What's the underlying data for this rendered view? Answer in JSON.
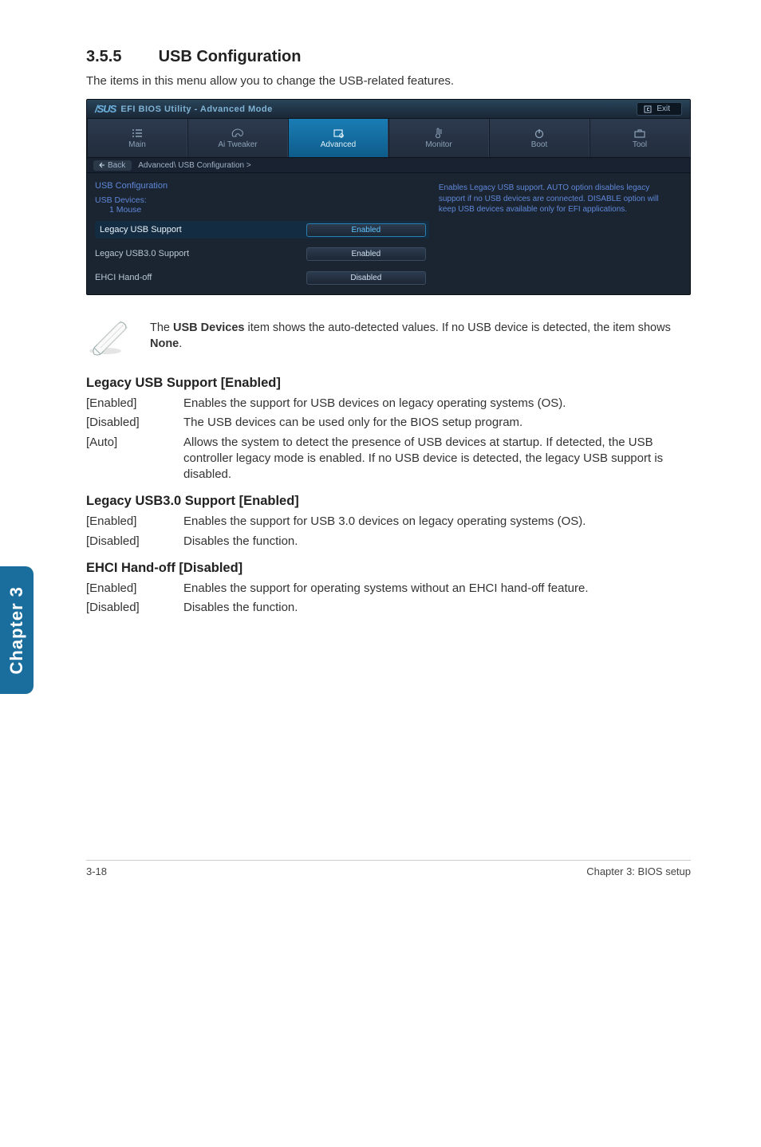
{
  "section": {
    "number": "3.5.5",
    "title": "USB Configuration"
  },
  "intro": "The items in this menu allow you to change the USB-related features.",
  "bios": {
    "logo_brand": "/SUS",
    "logo_title": "EFI BIOS Utility - Advanced Mode",
    "exit": "Exit",
    "tabs": {
      "main": "Main",
      "ai": "Ai Tweaker",
      "advanced": "Advanced",
      "monitor": "Monitor",
      "boot": "Boot",
      "tool": "Tool"
    },
    "breadcrumb": {
      "back": "Back",
      "path": "Advanced\\ USB Configuration  >"
    },
    "left": {
      "heading": "USB Configuration",
      "devices_label": "USB Devices:",
      "devices_value": "1 Mouse",
      "rows": {
        "legacy": {
          "label": "Legacy USB Support",
          "value": "Enabled"
        },
        "legacy30": {
          "label": "Legacy USB3.0 Support",
          "value": "Enabled"
        },
        "ehci": {
          "label": "EHCI Hand-off",
          "value": "Disabled"
        }
      }
    },
    "help": "Enables Legacy USB support. AUTO option disables legacy support if no USB devices are connected. DISABLE option will keep USB devices available only for EFI applications."
  },
  "note": {
    "pre": "The ",
    "b1": "USB Devices",
    "mid": " item shows the auto-detected values. If no USB device is detected, the item shows ",
    "b2": "None",
    "post": "."
  },
  "sections": {
    "legacy": {
      "title": "Legacy USB Support [Enabled]",
      "opts": {
        "enabled": {
          "k": "[Enabled]",
          "v": "Enables the support for USB devices on legacy operating systems (OS)."
        },
        "disabled": {
          "k": "[Disabled]",
          "v": "The USB devices can be used only for the BIOS setup program."
        },
        "auto": {
          "k": "[Auto]",
          "v": "Allows the system to detect the presence of USB devices at startup. If detected, the USB controller legacy mode is enabled. If no USB device is detected, the legacy USB support is disabled."
        }
      }
    },
    "legacy30": {
      "title": "Legacy USB3.0 Support [Enabled]",
      "opts": {
        "enabled": {
          "k": "[Enabled]",
          "v": "Enables the support for USB 3.0 devices on legacy operating systems (OS)."
        },
        "disabled": {
          "k": "[Disabled]",
          "v": "Disables the function."
        }
      }
    },
    "ehci": {
      "title": "EHCI Hand-off [Disabled]",
      "opts": {
        "enabled": {
          "k": "[Enabled]",
          "v": "Enables the support for operating systems without an EHCI hand-off feature."
        },
        "disabled": {
          "k": "[Disabled]",
          "v": "Disables the function."
        }
      }
    }
  },
  "side_tab": "Chapter 3",
  "footer": {
    "left": "3-18",
    "right": "Chapter 3: BIOS setup"
  }
}
